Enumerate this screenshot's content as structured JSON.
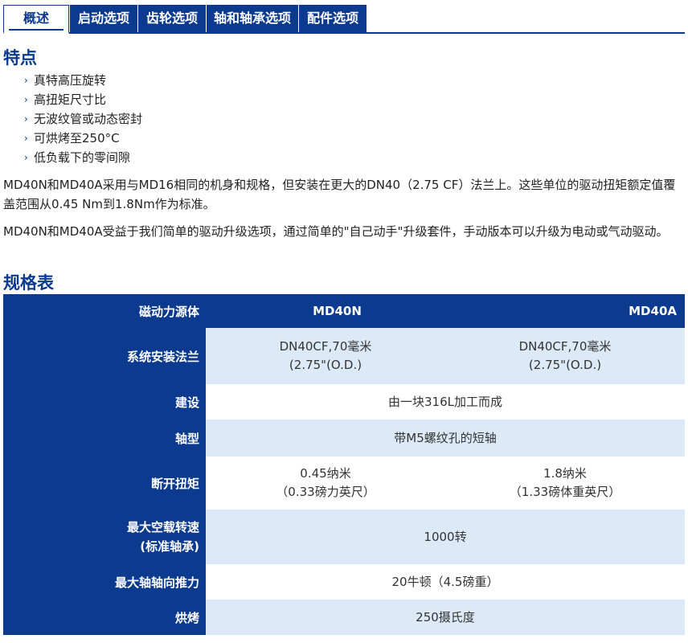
{
  "tabs": [
    {
      "label": "概述",
      "active": true
    },
    {
      "label": "启动选项",
      "active": false
    },
    {
      "label": "齿轮选项",
      "active": false
    },
    {
      "label": "轴和轴承选项",
      "active": false
    },
    {
      "label": "配件选项",
      "active": false
    }
  ],
  "features": {
    "heading": "特点",
    "items": [
      "真特高压旋转",
      "高扭矩尺寸比",
      "无波纹管或动态密封",
      "可烘烤至250°C",
      "低负载下的零间隙"
    ]
  },
  "paragraphs": [
    "MD40N和MD40A采用与MD16相同的机身和规格，但安装在更大的DN40（2.75 CF）法兰上。这些单位的驱动扭矩额定值覆盖范围从0.45 Nm到1.8Nm作为标准。",
    "MD40N和MD40A受益于我们简单的驱动升级选项，通过简单的\"自己动手\"升级套件，手动版本可以升级为电动或气动驱动。"
  ],
  "spec": {
    "heading": "规格表",
    "header": {
      "label": "磁动力源体",
      "col1": "MD40N",
      "col2": "MD40A"
    },
    "rows": [
      {
        "label": "系统安装法兰",
        "col1": [
          "DN40CF,70毫米",
          "(2.75\"(O.D.)"
        ],
        "col2": [
          "DN40CF,70毫米",
          "(2.75\"(O.D.)"
        ]
      },
      {
        "label": "建设",
        "span": "由一块316L加工而成"
      },
      {
        "label": "轴型",
        "span": "带M5螺纹孔的短轴"
      },
      {
        "label": "断开扭矩",
        "col1": [
          "0.45纳米",
          "（0.33磅力英尺）"
        ],
        "col2": [
          "1.8纳米",
          "（1.33磅体重英尺）"
        ]
      },
      {
        "label": [
          "最大空载转速",
          "(标准轴承)"
        ],
        "span": "1000转"
      },
      {
        "label": "最大轴轴向推力",
        "span": "20牛顿（4.5磅重）"
      },
      {
        "label": "烘烤",
        "span": "250摄氏度"
      }
    ]
  },
  "colors": {
    "accent": "#0b3a8f",
    "row_light": "#dceaf8"
  }
}
